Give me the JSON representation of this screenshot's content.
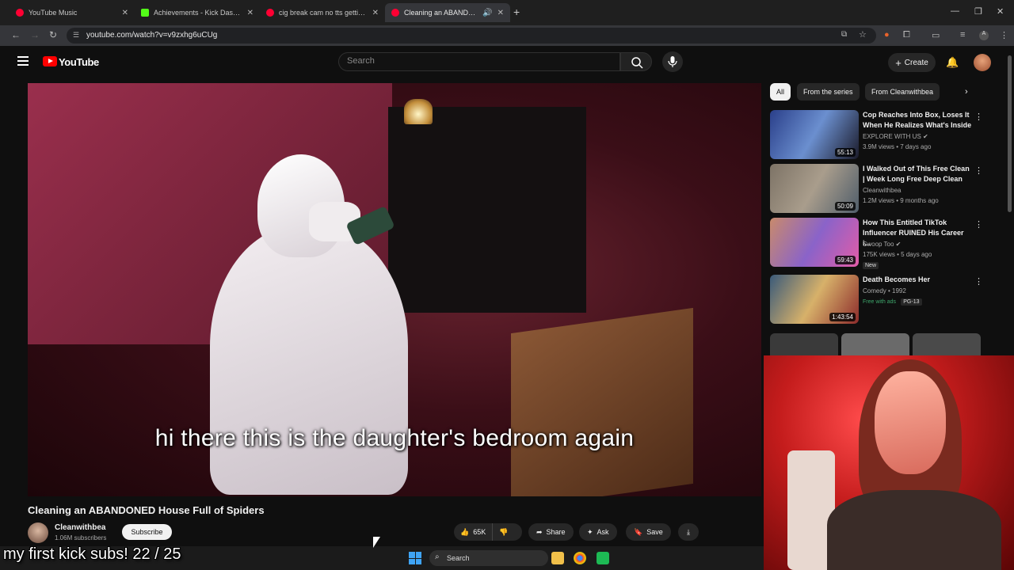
{
  "browser": {
    "tabs": [
      {
        "title": "YouTube Music",
        "favicon_color": "#ff0033"
      },
      {
        "title": "Achievements - Kick Dashboard",
        "favicon_color": "#53fc18"
      },
      {
        "title": "cig break cam no tts getting Ja",
        "favicon_color": "#ff0033"
      },
      {
        "title": "Cleaning an ABANDONED |",
        "favicon_color": "#ff0033",
        "active": true
      }
    ],
    "url": "youtube.com/watch?v=v9zxhg6uCUg"
  },
  "youtube": {
    "logo_text": "YouTube",
    "search_placeholder": "Search",
    "create_label": "Create"
  },
  "video": {
    "subtitle": "hi there this is the daughter's bedroom again",
    "title": "Cleaning an ABANDONED House Full of Spiders",
    "channel": "Cleanwithbea",
    "subscribers": "1.06M subscribers",
    "subscribe_label": "Subscribe",
    "likes": "65K",
    "share_label": "Share",
    "ask_label": "Ask",
    "save_label": "Save"
  },
  "chips": [
    "All",
    "From the series",
    "From Cleanwithbea"
  ],
  "recommendations": [
    {
      "title": "Cop Reaches Into Box, Loses It When He Realizes What's Inside",
      "channel": "EXPLORE WITH US",
      "meta": "3.9M views • 7 days ago",
      "duration": "55:13",
      "verified": true
    },
    {
      "title": "I Walked Out of This Free Clean | Week Long Free Deep Clean",
      "channel": "Cleanwithbea",
      "meta": "1.2M views • 9 months ago",
      "duration": "50:09"
    },
    {
      "title": "How This Entitled TikTok Influencer RUINED His Career i...",
      "channel": "Swoop Too",
      "meta": "175K views • 5 days ago",
      "duration": "59:43",
      "badge": "New",
      "verified": true
    },
    {
      "title": "Death Becomes Her",
      "channel": "Comedy • 1992",
      "meta_green": "Free with ads",
      "rating": "PG-13",
      "duration": "1:43:54"
    }
  ],
  "taskbar": {
    "search_label": "Search"
  },
  "overlay": {
    "goal_text": "my first kick subs!  22 / 25"
  },
  "colors": {
    "youtube_red": "#ff0000",
    "kick_green": "#53fc18",
    "background": "#0f0f0f"
  }
}
